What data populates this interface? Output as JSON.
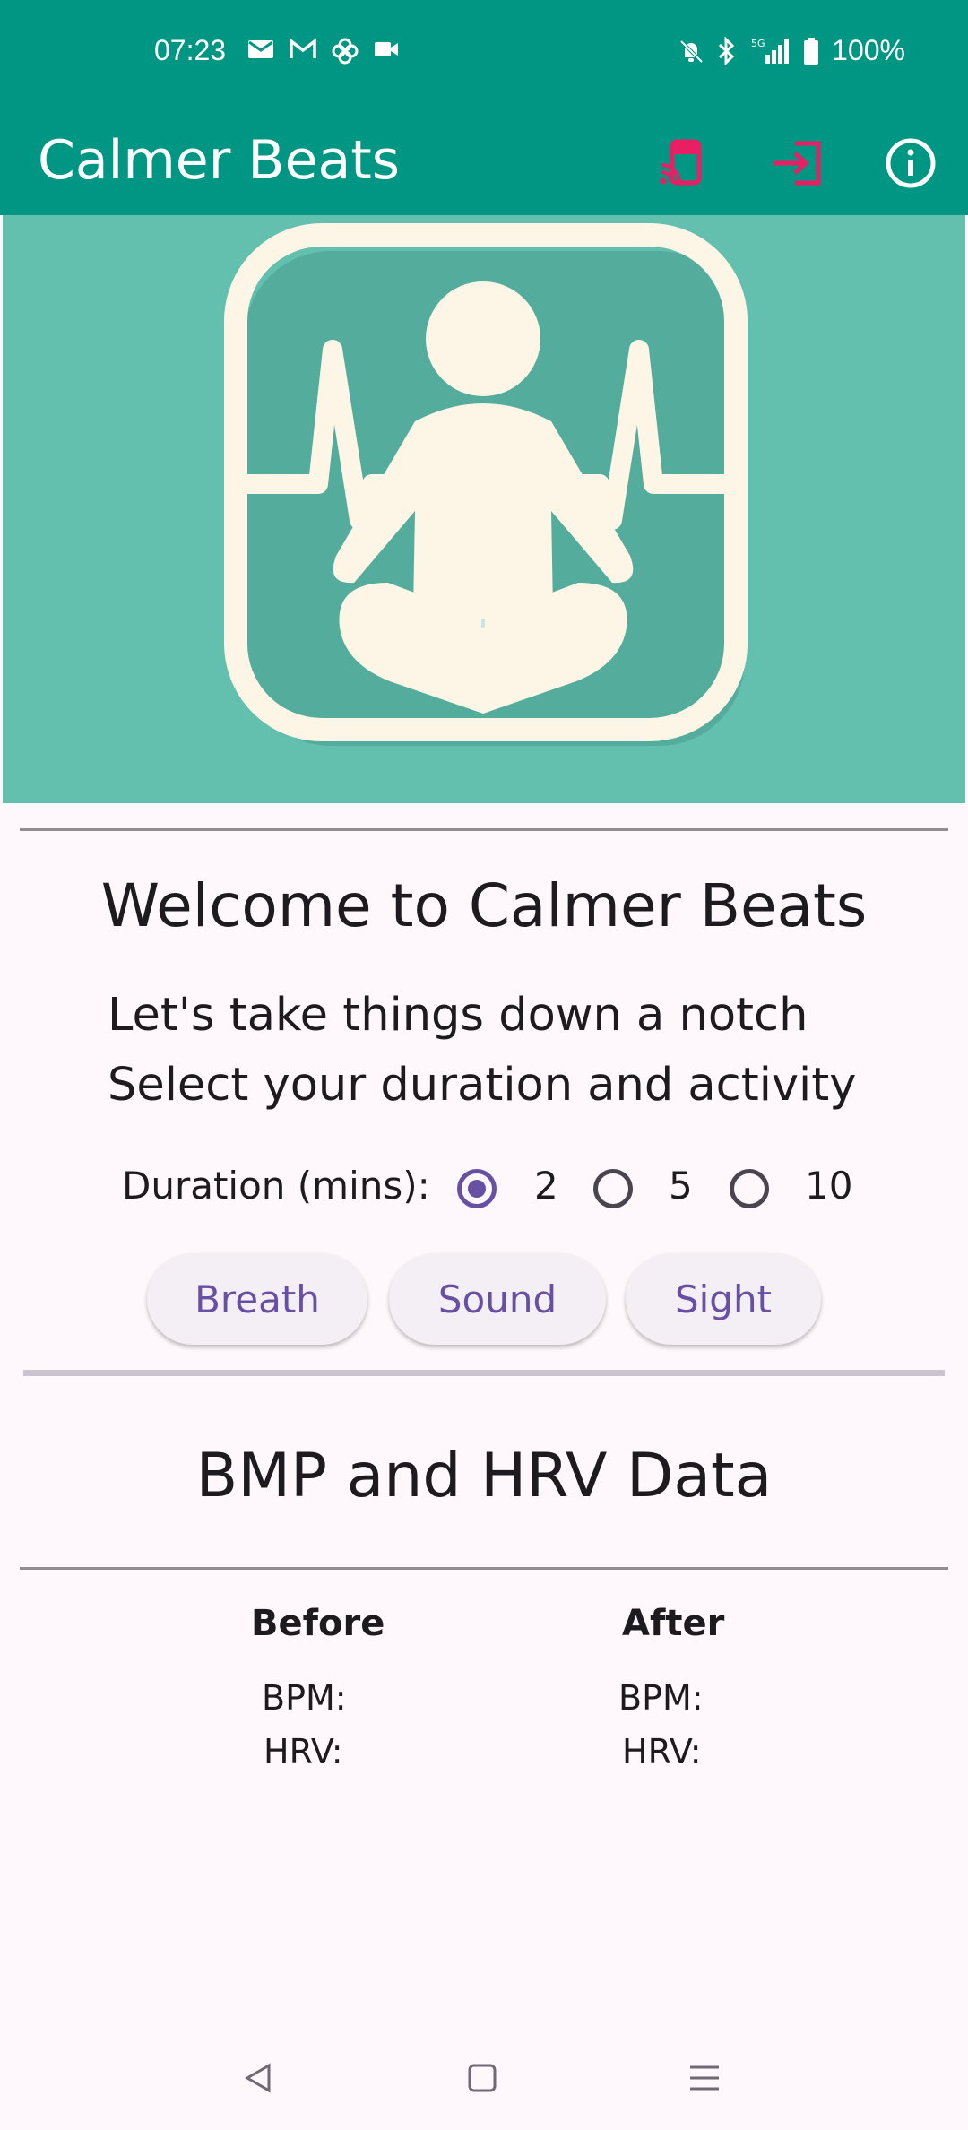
{
  "status_bar": {
    "time": "07:23",
    "battery": "100%",
    "left_icons": [
      "mail-icon",
      "gmail-icon",
      "pinwheel-icon",
      "video-camera-icon"
    ],
    "right_icons": [
      "bell-off-icon",
      "bluetooth-icon",
      "5g-signal-icon",
      "battery-icon"
    ]
  },
  "app_bar": {
    "title": "Calmer Beats",
    "actions": [
      "cast-icon",
      "login-icon",
      "info-icon"
    ],
    "action_color": "#e91e63"
  },
  "hero": {
    "image": "meditation-heartbeat-logo",
    "bg_color": "#63bfae",
    "fg_color": "#fdf6e7"
  },
  "welcome": {
    "title": "Welcome to Calmer Beats",
    "line1": "Let's take things down a notch",
    "line2": "Select your duration and activity"
  },
  "duration": {
    "label": "Duration (mins):",
    "options": [
      "2",
      "5",
      "10"
    ],
    "selected": "2"
  },
  "activities": [
    "Breath",
    "Sound",
    "Sight"
  ],
  "data_section": {
    "title": "BMP and HRV Data",
    "before": {
      "heading": "Before",
      "bpm_label": "BPM:",
      "hrv_label": "HRV:"
    },
    "after": {
      "heading": "After",
      "bpm_label": "BPM:",
      "hrv_label": "HRV:"
    }
  },
  "colors": {
    "primary": "#009684",
    "accent": "#6750a4",
    "background": "#fef8fc"
  }
}
